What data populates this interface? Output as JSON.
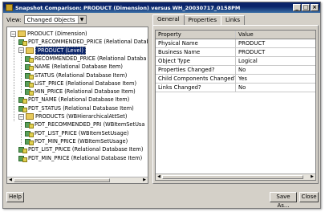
{
  "window": {
    "title": "Snapshot Comparison: PRODUCT (Dimension) versus WH_20030717_0158PM",
    "controls": [
      "_",
      "□",
      "×"
    ]
  },
  "view": {
    "label": "View:",
    "selected": "Changed Objects"
  },
  "tree": [
    {
      "label": "PRODUCT (Dimension)",
      "icon": "dimension-icon",
      "selected": false
    },
    {
      "label": "PDT_RECOMMENDED_PRICE (Relational Datab",
      "icon": "item-icon",
      "selected": false
    },
    {
      "label": "PRODUCT (Level)",
      "icon": "level-icon",
      "selected": true
    },
    {
      "label": "RECOMMENDED_PRICE (Relational Databa",
      "icon": "item-icon",
      "selected": false
    },
    {
      "label": "NAME (Relational Database Item)",
      "icon": "item-icon",
      "selected": false
    },
    {
      "label": "STATUS (Relational Database Item)",
      "icon": "item-icon",
      "selected": false
    },
    {
      "label": "LIST_PRICE (Relational Database Item)",
      "icon": "item-icon",
      "selected": false
    },
    {
      "label": "MIN_PRICE (Relational Database Item)",
      "icon": "item-icon",
      "selected": false
    },
    {
      "label": "PDT_NAME (Relational Database Item)",
      "icon": "item-icon",
      "selected": false
    },
    {
      "label": "PDT_STATUS (Relational Database Item)",
      "icon": "item-icon",
      "selected": false
    },
    {
      "label": "PRODUCTS (WBHierarchicalAttSet)",
      "icon": "attset-icon",
      "selected": false
    },
    {
      "label": "PDT_RECOMMENDED_PRI (WBItemSetUsa",
      "icon": "item-icon",
      "selected": false
    },
    {
      "label": "PDT_LIST_PRICE (WBItemSetUsage)",
      "icon": "item-icon",
      "selected": false
    },
    {
      "label": "PDT_MIN_PRICE (WBItemSetUsage)",
      "icon": "item-icon",
      "selected": false
    },
    {
      "label": "PDT_LIST_PRICE (Relational Database Item)",
      "icon": "item-icon",
      "selected": false
    },
    {
      "label": "PDT_MIN_PRICE (Relational Database Item)",
      "icon": "item-icon",
      "selected": false
    }
  ],
  "tabs": [
    "General",
    "Properties",
    "Links"
  ],
  "grid": {
    "headers": [
      "Property",
      "Value"
    ],
    "rows": [
      [
        "Physical Name",
        "PRODUCT"
      ],
      [
        "Business Name",
        "PRODUCT"
      ],
      [
        "Object Type",
        "Logical"
      ],
      [
        "Properties Changed?",
        "No"
      ],
      [
        "Child Components Changed?",
        "Yes"
      ],
      [
        "Links Changed?",
        "No"
      ]
    ]
  },
  "buttons": {
    "help": "Help",
    "save_as": "Save As...",
    "close": "Close"
  }
}
